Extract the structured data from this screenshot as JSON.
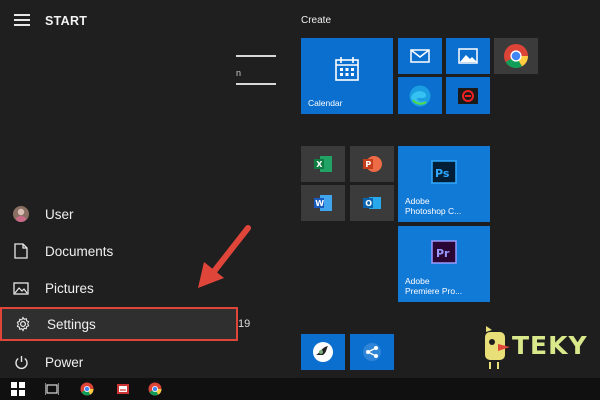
{
  "start_menu": {
    "header": {
      "title": "START"
    },
    "items": [
      {
        "label": "User"
      },
      {
        "label": "Documents"
      },
      {
        "label": "Pictures"
      },
      {
        "label": "Settings"
      },
      {
        "label": "Power"
      }
    ],
    "partial_letter": "n",
    "partial_number": "19"
  },
  "tiles": {
    "group_title": "Create",
    "calendar": {
      "label": "Calendar"
    },
    "photoshop": {
      "label": "Adobe\nPhotoshop C..."
    },
    "premiere": {
      "label": "Adobe\nPremiere Pro..."
    }
  },
  "icons": {
    "hamburger": "hamburger-icon",
    "calendar": "calendar-icon",
    "mail": "mail-icon",
    "photos": "photos-icon",
    "chrome": "chrome-icon",
    "edge": "edge-icon",
    "excel": "excel-icon",
    "powerpoint": "powerpoint-icon",
    "word": "word-icon",
    "outlook": "outlook-icon",
    "photoshop": "photoshop-icon",
    "premiere": "premiere-icon"
  },
  "colors": {
    "tile_blue": "#0a6fcf",
    "highlight_border": "#e0453a",
    "arrow": "#e0453a"
  },
  "watermark": {
    "text": "TEKY"
  }
}
